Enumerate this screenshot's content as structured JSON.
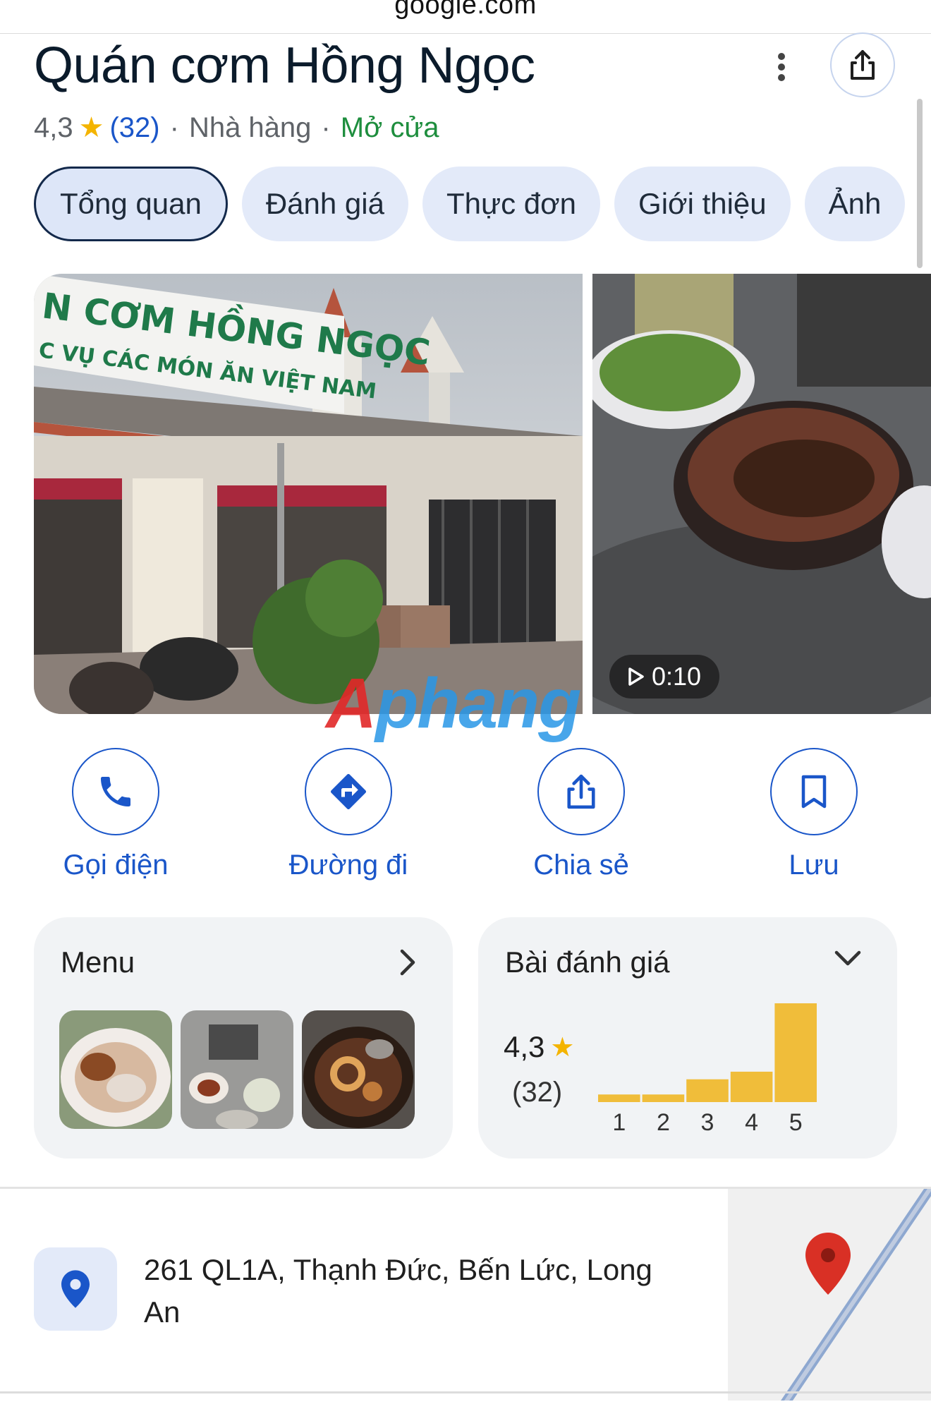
{
  "browser": {
    "url": "google.com"
  },
  "place": {
    "name": "Quán cơm Hồng Ngọc",
    "rating": "4,3",
    "review_count": "(32)",
    "category": "Nhà hàng",
    "status": "Mở cửa",
    "separator": "·"
  },
  "tabs": [
    {
      "label": "Tổng quan",
      "active": true
    },
    {
      "label": "Đánh giá"
    },
    {
      "label": "Thực đơn"
    },
    {
      "label": "Giới thiệu"
    },
    {
      "label": "Ảnh"
    }
  ],
  "photos": {
    "sign_line1": "N CƠM HỒNG NGỌC",
    "sign_line2": "C VỤ CÁC MÓN ĂN VIỆT NAM",
    "video_duration": "0:10",
    "watermark": "Aphang"
  },
  "actions": [
    {
      "label": "Gọi điện",
      "icon": "phone-icon"
    },
    {
      "label": "Đường đi",
      "icon": "directions-icon"
    },
    {
      "label": "Chia sẻ",
      "icon": "share-icon"
    },
    {
      "label": "Lưu",
      "icon": "bookmark-icon"
    }
  ],
  "menu_card": {
    "title": "Menu",
    "icon": "chevron-right-icon"
  },
  "review_card": {
    "title": "Bài đánh giá",
    "rating": "4,3",
    "count": "(32)",
    "icon": "chevron-down-icon"
  },
  "chart_data": {
    "type": "bar",
    "categories": [
      "1",
      "2",
      "3",
      "4",
      "5"
    ],
    "values": [
      1,
      1,
      3,
      4,
      13
    ],
    "title": "",
    "xlabel": "",
    "ylabel": "",
    "bar_color": "#f0bd3a"
  },
  "address": {
    "text": "261 QL1A, Thạnh Đức, Bến Lức, Long An"
  },
  "colors": {
    "accent_blue": "#1a56c9",
    "open_green": "#1e8e3e",
    "star_yellow": "#f4b400",
    "chip_bg": "#e3eaf9"
  }
}
